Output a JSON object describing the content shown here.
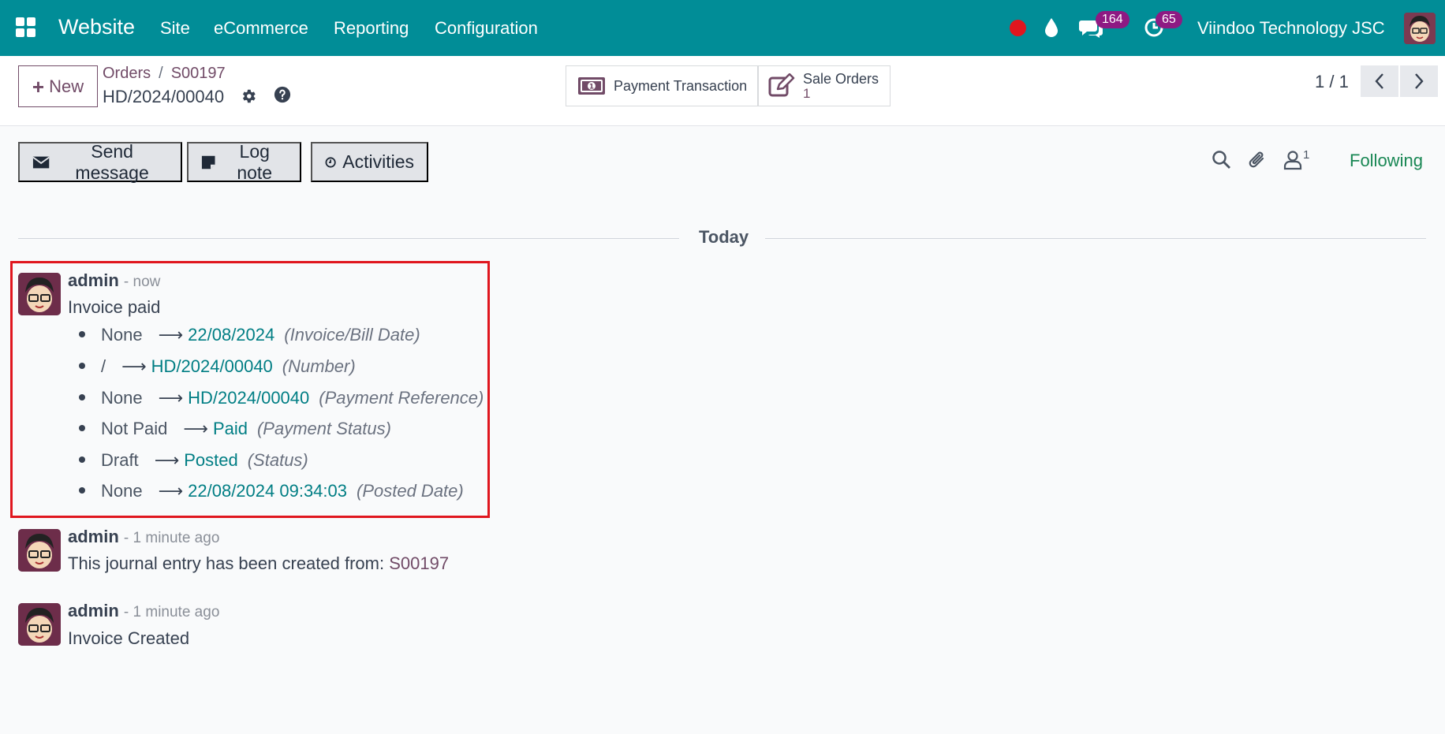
{
  "navbar": {
    "app_name": "Website",
    "menus": [
      "Site",
      "eCommerce",
      "Reporting",
      "Configuration"
    ],
    "messages_count": "164",
    "activities_count": "65",
    "company": "Viindoo Technology JSC"
  },
  "control": {
    "new_label": "New",
    "breadcrumb": [
      "Orders",
      "S00197"
    ],
    "record_name": "HD/2024/00040",
    "smart_buttons": [
      {
        "label": "Payment Transaction"
      },
      {
        "label": "Sale Orders",
        "count": "1"
      }
    ],
    "pager": "1 / 1"
  },
  "chatter": {
    "send_message": "Send message",
    "log_note": "Log note",
    "activities": "Activities",
    "followers_count": "1",
    "following": "Following",
    "day_separator": "Today"
  },
  "messages": [
    {
      "author": "admin",
      "when": "- now",
      "body": "Invoice paid",
      "tracking": [
        {
          "old": "None",
          "new": "22/08/2024",
          "field": "(Invoice/Bill Date)"
        },
        {
          "old": "/",
          "new": "HD/2024/00040",
          "field": "(Number)"
        },
        {
          "old": "None",
          "new": "HD/2024/00040",
          "field": "(Payment Reference)"
        },
        {
          "old": "Not Paid",
          "new": "Paid",
          "field": "(Payment Status)"
        },
        {
          "old": "Draft",
          "new": "Posted",
          "field": "(Status)"
        },
        {
          "old": "None",
          "new": "22/08/2024 09:34:03",
          "field": "(Posted Date)"
        }
      ]
    },
    {
      "author": "admin",
      "when": "- 1 minute ago",
      "body": "This journal entry has been created from:",
      "link": "S00197"
    },
    {
      "author": "admin",
      "when": "- 1 minute ago",
      "body": "Invoice Created"
    }
  ],
  "colors": {
    "navbar": "#018d97",
    "brand_purple": "#714b67",
    "tracking_value": "#017e84",
    "following": "#198754",
    "highlight": "#e0161e"
  }
}
